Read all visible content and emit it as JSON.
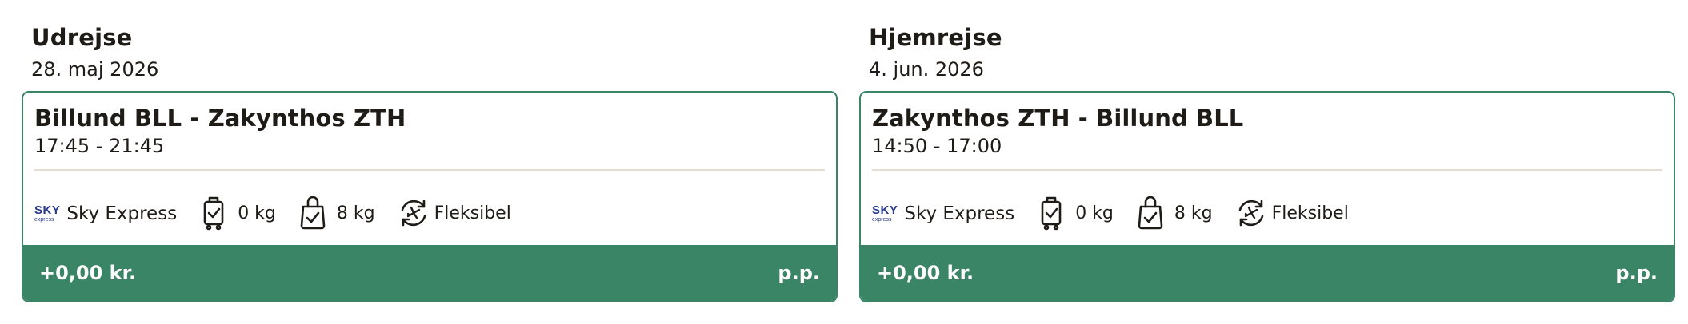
{
  "outbound": {
    "heading": "Udrejse",
    "date": "28. maj 2026",
    "route": "Billund BLL - Zakynthos ZTH",
    "times": "17:45 - 21:45",
    "airline": {
      "logo_top": "SKY",
      "logo_bottom": "express",
      "name": "Sky Express",
      "icon": "sky-express-logo"
    },
    "features": [
      {
        "icon": "carry-on-bag-icon",
        "label": "0 kg"
      },
      {
        "icon": "personal-bag-icon",
        "label": "8 kg"
      },
      {
        "icon": "flexible-flight-icon",
        "label": "Fleksibel"
      }
    ],
    "price": "+0,00 kr.",
    "per_person": "p.p."
  },
  "return": {
    "heading": "Hjemrejse",
    "date": "4. jun. 2026",
    "route": "Zakynthos ZTH - Billund BLL",
    "times": "14:50 - 17:00",
    "airline": {
      "logo_top": "SKY",
      "logo_bottom": "express",
      "name": "Sky Express",
      "icon": "sky-express-logo"
    },
    "features": [
      {
        "icon": "carry-on-bag-icon",
        "label": "0 kg"
      },
      {
        "icon": "personal-bag-icon",
        "label": "8 kg"
      },
      {
        "icon": "flexible-flight-icon",
        "label": "Fleksibel"
      }
    ],
    "price": "+0,00 kr.",
    "per_person": "p.p."
  },
  "colors": {
    "accent_green": "#3b8567",
    "text": "#1f1b17",
    "divider": "#e4ddd2",
    "airline_blue": "#2a3a8c"
  }
}
